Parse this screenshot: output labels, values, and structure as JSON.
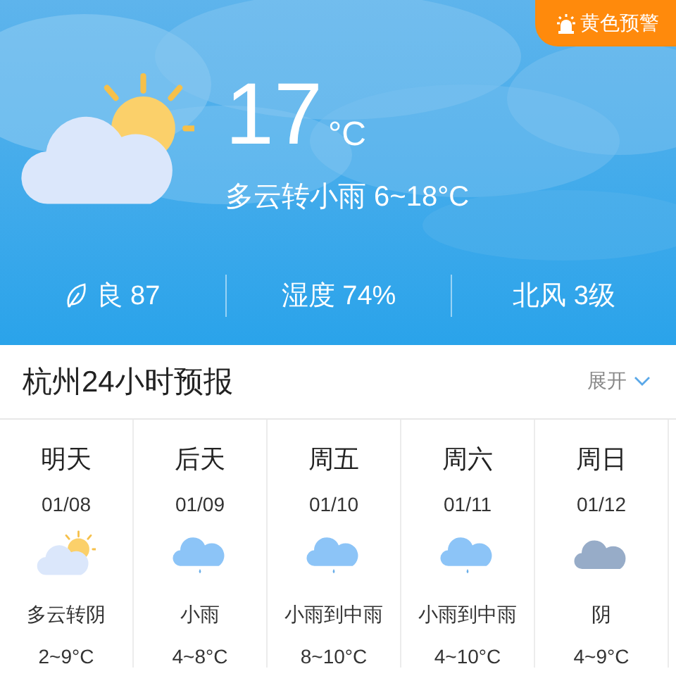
{
  "alert": {
    "label": "黄色预警"
  },
  "current": {
    "kind": "partly-cloudy",
    "temperature": "17",
    "unit": "°C",
    "summary": "多云转小雨 6~18°C"
  },
  "stats": [
    {
      "kind": "air",
      "text": "良 87"
    },
    {
      "kind": "plain",
      "text": "湿度 74%"
    },
    {
      "kind": "plain",
      "text": "北风 3级"
    }
  ],
  "forecast": {
    "title": "杭州24小时预报",
    "toggle": "展开",
    "days": [
      {
        "day": "明天",
        "date": "01/08",
        "kind": "partly-cloudy",
        "weather": "多云转阴",
        "temp": "2~9°C"
      },
      {
        "day": "后天",
        "date": "01/09",
        "kind": "rain",
        "weather": "小雨",
        "temp": "4~8°C"
      },
      {
        "day": "周五",
        "date": "01/10",
        "kind": "rain",
        "weather": "小雨到中雨",
        "temp": "8~10°C"
      },
      {
        "day": "周六",
        "date": "01/11",
        "kind": "rain",
        "weather": "小雨到中雨",
        "temp": "4~10°C"
      },
      {
        "day": "周日",
        "date": "01/12",
        "kind": "cloudy",
        "weather": "阴",
        "temp": "4~9°C"
      }
    ]
  }
}
